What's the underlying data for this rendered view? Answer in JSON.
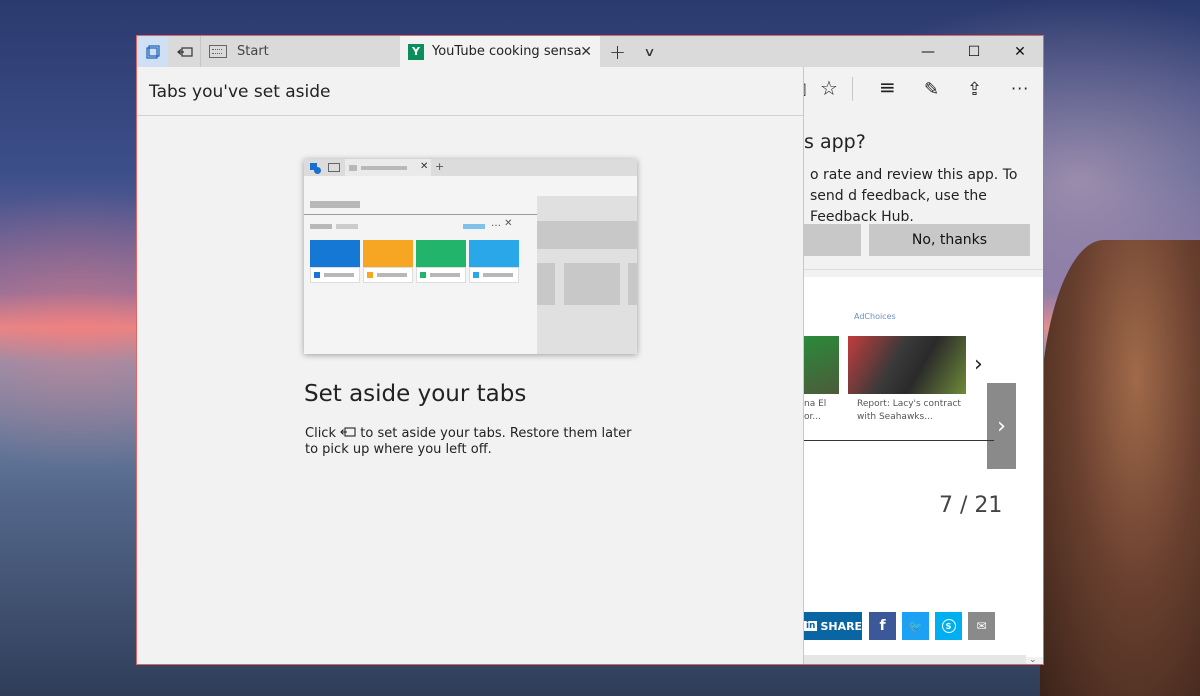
{
  "titlebar": {
    "tabs": [
      {
        "label": "Start"
      },
      {
        "label": "YouTube cooking sensa",
        "favicon": "Y"
      }
    ],
    "icons": {
      "tabs_aside": "tabs-aside-icon",
      "set_aside": "set-aside-icon",
      "new_tab": "+",
      "tab_list": "∨",
      "close_tab": "✕"
    },
    "window_controls": {
      "minimize": "—",
      "maximize": "☐",
      "close": "✕"
    }
  },
  "toolbar": {
    "favorite": "☆",
    "hub": "≡",
    "notes": "✎",
    "share": "⇪",
    "more": "···"
  },
  "panel": {
    "header": "Tabs you've set aside",
    "title": "Set aside your tabs",
    "body_prefix": "Click",
    "body_suffix": "to set aside your tabs. Restore them later to pick up where you left off."
  },
  "popup": {
    "title": "s app?",
    "body": "o rate and review this app. To send d feedback, use the Feedback Hub.",
    "no_thanks": "No, thanks"
  },
  "content": {
    "adchoices": "AdChoices",
    "captions": [
      {
        "line1": "na El",
        "line2": "or..."
      },
      {
        "line1": "Report: Lacy's contract",
        "line2": "with Seahawks..."
      }
    ],
    "counter": "7 / 21",
    "share_label": "SHARE"
  },
  "colors": {
    "window_border": "#dd6666",
    "linkedin": "#0a66a2",
    "facebook": "#3b5998",
    "twitter": "#1da1f2",
    "skype": "#00aff0",
    "email": "#8a8a8a",
    "card_blue": "#1478d4",
    "card_orange": "#f6a623",
    "card_green": "#21b46a",
    "card_lightblue": "#2aa7e8"
  }
}
